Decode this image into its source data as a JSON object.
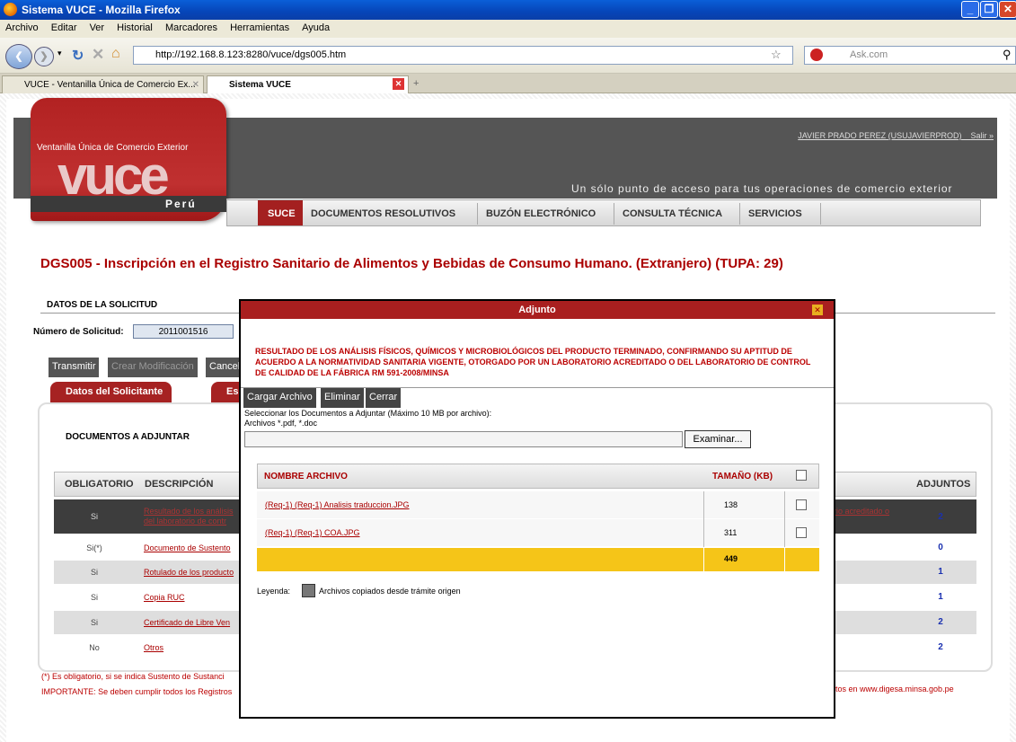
{
  "browser": {
    "window_title": "Sistema VUCE - Mozilla Firefox",
    "menu": [
      "Archivo",
      "Editar",
      "Ver",
      "Historial",
      "Marcadores",
      "Herramientas",
      "Ayuda"
    ],
    "url": "http://192.168.8.123:8280/vuce/dgs005.htm",
    "search_placeholder": "Ask.com",
    "tabs": [
      {
        "label": "VUCE - Ventanilla Única de Comercio Ex..."
      },
      {
        "label": "Sistema VUCE"
      }
    ],
    "new_tab": "+"
  },
  "site": {
    "logo_small": "Ventanilla Única de Comercio Exterior",
    "logo_big": "vuce",
    "logo_country": "Perú",
    "user": "JAVIER PRADO PEREZ (USUJAVIERPROD)",
    "logout": "Salir »",
    "tagline": "Un sólo punto de acceso para tus operaciones de comercio exterior",
    "menu": [
      "SUCE",
      "DOCUMENTOS RESOLUTIVOS",
      "BUZÓN ELECTRÓNICO",
      "CONSULTA TÉCNICA",
      "SERVICIOS"
    ]
  },
  "main": {
    "title": "DGS005 - Inscripción en el Registro Sanitario de Alimentos y Bebidas de Consumo Humano. (Extranjero) (TUPA: 29)",
    "section": "DATOS DE LA SOLICITUD",
    "numsol_label": "Número de Solicitud:",
    "numsol_value": "2011001516",
    "btn_transmitir": "Transmitir",
    "btn_crear": "Crear Modificación",
    "btn_cancelar": "Cancelar",
    "tab1": "Datos del Solicitante",
    "tab2": "Es",
    "documentos": "DOCUMENTOS A ADJUNTAR",
    "headers": {
      "obligatorio": "OBLIGATORIO",
      "descripcion": "DESCRIPCIÓN",
      "adjuntos": "ADJUNTOS"
    },
    "rows": [
      {
        "obligatorio": "Si",
        "descripcion": "Resultado de los análisis del laboratorio de contr",
        "right": "rio acreditado o",
        "adjuntos": "2"
      },
      {
        "obligatorio": "Si(*)",
        "descripcion": "Documento de Sustento",
        "adjuntos": "0"
      },
      {
        "obligatorio": "Si",
        "descripcion": "Rotulado de los producto",
        "adjuntos": "1"
      },
      {
        "obligatorio": "Si",
        "descripcion": "Copia RUC",
        "adjuntos": "1"
      },
      {
        "obligatorio": "Si",
        "descripcion": "Certificado de Libre Ven",
        "adjuntos": "2"
      },
      {
        "obligatorio": "No",
        "descripcion": "Otros",
        "adjuntos": "2"
      }
    ],
    "note1": "(*) Es obligatorio, si se indica Sustento de Sustanci",
    "note2": "IMPORTANTE: Se deben cumplir todos los Registros",
    "note2_right": "tos en www.digesa.minsa.gob.pe"
  },
  "modal": {
    "title": "Adjunto",
    "description": "RESULTADO DE LOS ANÁLISIS FÍSICOS, QUÍMICOS Y MICROBIOLÓGICOS DEL PRODUCTO TERMINADO, CONFIRMANDO SU APTITUD DE ACUERDO A LA NORMATIVIDAD SANITARIA VIGENTE, OTORGADO POR UN LABORATORIO ACREDITADO O DEL LABORATORIO DE CONTROL DE CALIDAD DE LA FÁBRICA RM 591-2008/MINSA",
    "btn_cargar": "Cargar Archivo",
    "btn_eliminar": "Eliminar",
    "btn_cerrar": "Cerrar",
    "select_text": "Seleccionar los Documentos a Adjuntar (Máximo 10 MB por archivo):",
    "types_text": "Archivos *.pdf, *.doc",
    "btn_examinar": "Examinar...",
    "col_nombre": "NOMBRE ARCHIVO",
    "col_tamano": "TAMAÑO (KB)",
    "files": [
      {
        "name": "(Req-1) (Req-1) Analisis traduccion.JPG",
        "size": "138"
      },
      {
        "name": "(Req-1) (Req-1) COA.JPG",
        "size": "311"
      }
    ],
    "total": "449",
    "leyenda": "Leyenda:",
    "leyenda_text": "Archivos copiados desde trámite origen"
  }
}
